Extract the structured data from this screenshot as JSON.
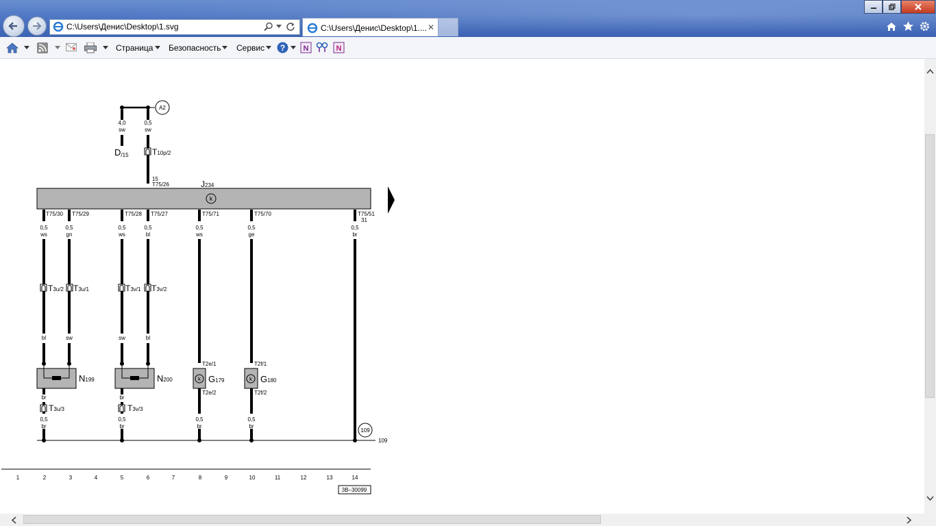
{
  "browser": {
    "address": "C:\\Users\\Денис\\Desktop\\1.svg",
    "tab_title": "C:\\Users\\Денис\\Desktop\\1....",
    "tab_close": "✕",
    "menus": [
      "Страница",
      "Безопасность",
      "Сервис"
    ]
  },
  "diagram": {
    "top_label_a2": "A2",
    "d_main": "D",
    "d_sub": "/15",
    "t10p_main": "T",
    "t10p_sub": "10p/2",
    "wire_top_left": [
      "4,0",
      "sw"
    ],
    "wire_top_right": [
      "0,5",
      "sw"
    ],
    "pin15": "15",
    "t75_26": "T75/26",
    "j_main": "J",
    "j_sub": "234",
    "pins_top": [
      "T75/30",
      "T75/29",
      "T75/28",
      "T75/27",
      "T75/71",
      "T75/70",
      "T75/51"
    ],
    "pin31": "31",
    "wires": [
      [
        "0,5",
        "ws"
      ],
      [
        "0,5",
        "gn"
      ],
      [
        "0,5",
        "ws"
      ],
      [
        "0,5",
        "bl"
      ],
      [
        "0,5",
        "ws"
      ],
      [
        "0,5",
        "ge"
      ],
      [
        "0,5",
        "br"
      ]
    ],
    "conn_t3u2": [
      "T",
      "3u/2"
    ],
    "conn_t3u1": [
      "T",
      "3u/1"
    ],
    "conn_t3v1": [
      "T",
      "3v/1"
    ],
    "conn_t3v2": [
      "T",
      "3v/2"
    ],
    "colors_mid": [
      "bl",
      "sw",
      "sw",
      "bl"
    ],
    "t2e1": "T2e/1",
    "t2e2": "T2e/2",
    "t2f1": "T2f/1",
    "t2f2": "T2f/2",
    "n199": [
      "N",
      "199"
    ],
    "n200": [
      "N",
      "200"
    ],
    "g179": [
      "G",
      "179"
    ],
    "g180": [
      "G",
      "180"
    ],
    "br": "br",
    "t3u3": [
      "T",
      "3u/3"
    ],
    "t3v3": [
      "T",
      "3v/3"
    ],
    "bottom_wires": [
      [
        "0,5",
        "br"
      ],
      [
        "0,5",
        "br"
      ],
      [
        "0,5",
        "br"
      ],
      [
        "0,5",
        "br"
      ]
    ],
    "ground_marker": "109",
    "ground_label": "109",
    "ruler": [
      "1",
      "2",
      "3",
      "4",
      "5",
      "6",
      "7",
      "8",
      "9",
      "10",
      "11",
      "12",
      "13",
      "14"
    ],
    "drawing_id": "3B–30099",
    "k_symbol": "k"
  }
}
